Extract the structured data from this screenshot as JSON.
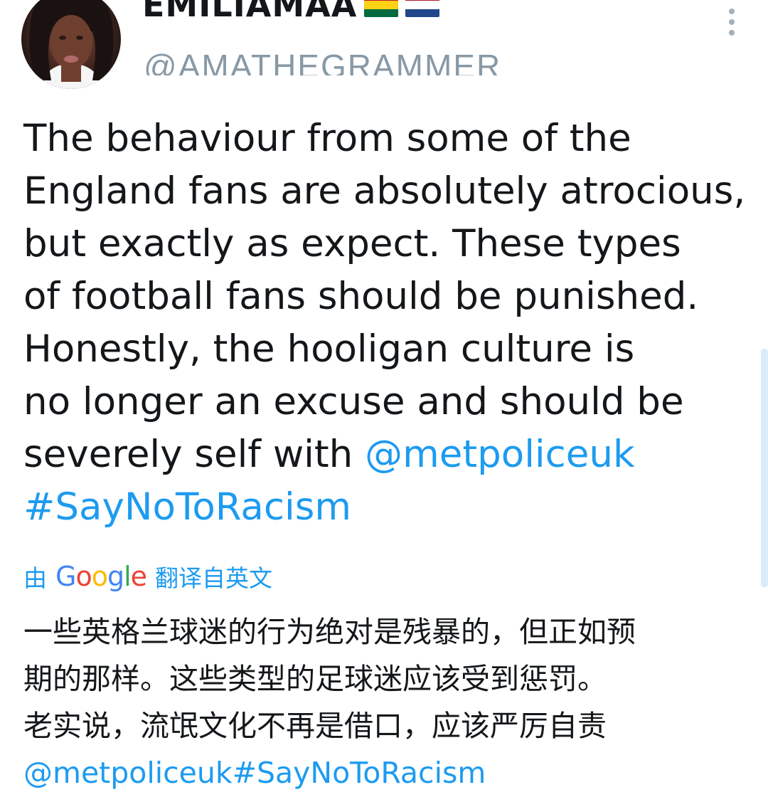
{
  "user": {
    "display_name": "EMILIAMAA",
    "handle": "@AMATHEGRAMMER"
  },
  "tweet": {
    "lines": [
      "The behaviour from some of the",
      "England fans are absolutely atrocious,",
      "but exactly as expect. These types",
      "of football fans should be punished.",
      "Honestly, the hooligan culture is",
      "no longer an excuse and should be",
      "severely self with "
    ],
    "mention": "@metpoliceuk",
    "hashtag": "#SayNoToRacism"
  },
  "translation": {
    "prefix": "由",
    "provider": "Google",
    "suffix": "翻译自英文",
    "lines": [
      "一些英格兰球迷的行为绝对是残暴的，但正如预",
      "期的那样。这些类型的足球迷应该受到惩罚。",
      "老实说，流氓文化不再是借口，应该严厉自责"
    ],
    "mention": "@metpoliceuk",
    "hashtag": "#SayNoToRacism"
  },
  "icons": {
    "menu": "more-vertical-icon",
    "flag": "flag-icon",
    "avatar": "profile-photo"
  },
  "colors": {
    "link": "#1d9bf0",
    "handle": "#8899a6",
    "text": "#14171a"
  }
}
